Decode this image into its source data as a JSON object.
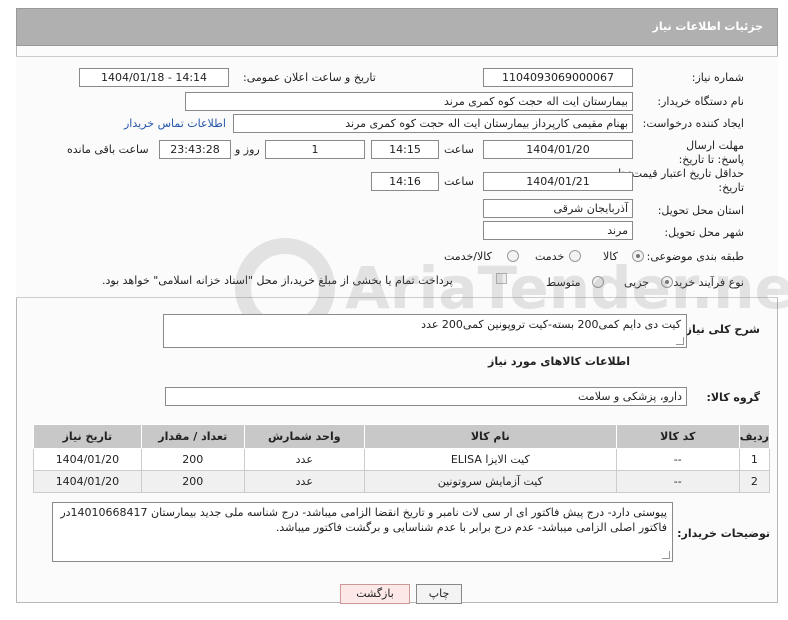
{
  "header": {
    "title": "جزئیات اطلاعات نیاز"
  },
  "form": {
    "need_number_label": "شماره نیاز:",
    "need_number": "1104093069000067",
    "announce_label": "تاریخ و ساعت اعلان عمومی:",
    "announce_value": "1404/01/18 - 14:14",
    "buyer_label": "نام دستگاه خریدار:",
    "buyer_value": "بیمارستان ایت اله حجت کوه کمری مرند",
    "creator_label": "ایجاد کننده درخواست:",
    "creator_value": "بهنام مقیمی کارپرداز بیمارستان ایت اله حجت کوه کمری مرند",
    "contact_link": "اطلاعات تماس خریدار",
    "deadline_label": "مهلت ارسال پاسخ: تا تاریخ:",
    "deadline_date": "1404/01/20",
    "time_label": "ساعت",
    "deadline_time": "14:15",
    "days_value": "1",
    "days_label": "روز و",
    "remaining_value": "23:43:28",
    "remaining_label": "ساعت باقی مانده",
    "validity_label": "حداقل تاریخ اعتبار قیمت: تا تاریخ:",
    "validity_date": "1404/01/21",
    "validity_time": "14:16",
    "province_label": "استان محل تحویل:",
    "province_value": "آذربایجان شرقی",
    "city_label": "شهر محل تحویل:",
    "city_value": "مرند",
    "category_label": "طبقه بندی موضوعی:",
    "category_options": [
      "کالا",
      "خدمت",
      "کالا/خدمت"
    ],
    "category_selected": "کالا",
    "process_label": "نوع فرآیند خرید :",
    "process_options": [
      "جزیی",
      "متوسط"
    ],
    "process_selected": "جزیی",
    "payment_note": "پرداخت تمام یا بخشی از مبلغ خرید،از محل \"اسناد خزانه اسلامی\" خواهد بود."
  },
  "general_desc": {
    "label": "شرح کلی نیاز:",
    "value": "کیت دی دایم کمی200 بسته-کیت تروپونین کمی200 عدد"
  },
  "goods_info_title": "اطلاعات کالاهای مورد نیاز",
  "goods_group": {
    "label": "گروه کالا:",
    "value": "دارو، پزشکی و سلامت"
  },
  "table": {
    "headers": [
      "ردیف",
      "کد کالا",
      "نام کالا",
      "واحد شمارش",
      "تعداد / مقدار",
      "تاریخ نیاز"
    ],
    "rows": [
      [
        "1",
        "--",
        "کیت الایزا ELISA",
        "عدد",
        "200",
        "1404/01/20"
      ],
      [
        "2",
        "--",
        "کیت آزمایش سروتونین",
        "عدد",
        "200",
        "1404/01/20"
      ]
    ]
  },
  "buyer_notes": {
    "label": "توضیحات خریدار:",
    "value": "پیوستی دارد- درج پیش فاکتور ای ار سی لات نامبر و تاریخ انقضا الزامی میباشد- درج شناسه ملی  جدید بیمارستان 14010668417در فاکتور اصلی الزامی میباشد- عدم درج برابر با عدم شناسایی و برگشت فاکتور میباشد."
  },
  "buttons": {
    "print": "چاپ",
    "back": "بازگشت"
  },
  "watermark": {
    "text": "AriaTender.neT"
  }
}
